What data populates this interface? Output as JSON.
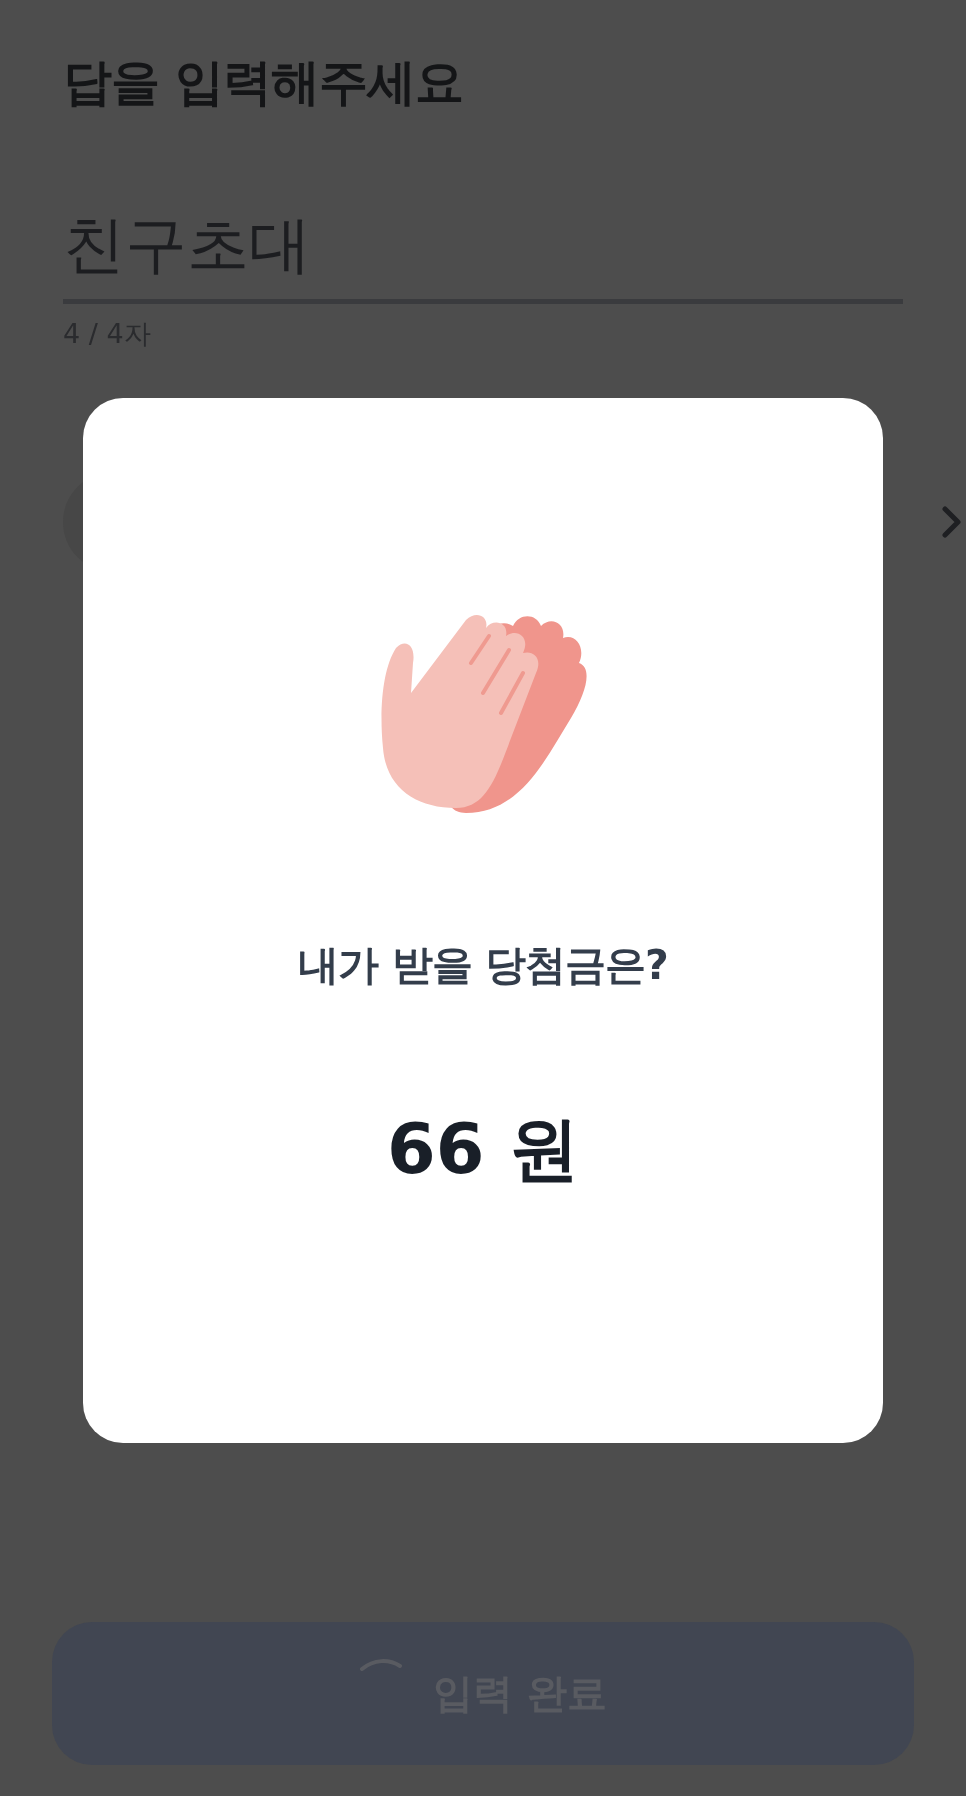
{
  "title": "답을 입력해주세요",
  "answer": {
    "value": "친구초대"
  },
  "counter": "4 / 4자",
  "modal": {
    "question": "내가 받을 당첨금은?",
    "amount": "66 원"
  },
  "submit_button": {
    "label": "입력 완료",
    "loading": true,
    "disabled": true
  }
}
